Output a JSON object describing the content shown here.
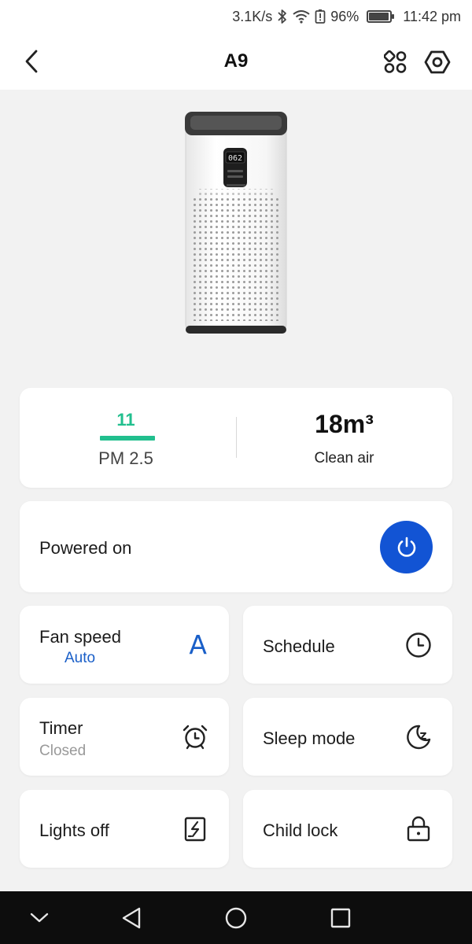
{
  "status_bar": {
    "speed": "3.1K/s",
    "battery": "96%",
    "battery_level": 0.96,
    "time": "11:42 pm",
    "icons": [
      "bluetooth-icon",
      "wifi-icon",
      "battery-alert-icon",
      "battery-icon"
    ]
  },
  "header": {
    "title": "A9",
    "icons": [
      "back-icon",
      "apps-icon",
      "settings-icon"
    ]
  },
  "device": {
    "display_reading": "062",
    "image_icon": "air-purifier-image"
  },
  "stats": {
    "pm_value": "11",
    "pm_label": "PM 2.5",
    "air_value": "18m³",
    "air_label": "Clean air"
  },
  "power": {
    "label": "Powered on",
    "state": "on",
    "icon": "power-icon"
  },
  "tiles": {
    "fan_speed": {
      "label": "Fan speed",
      "value": "Auto",
      "icon_text": "A"
    },
    "schedule": {
      "label": "Schedule",
      "icon": "clock-icon"
    },
    "timer": {
      "label": "Timer",
      "value": "Closed",
      "icon": "alarm-clock-icon"
    },
    "sleep_mode": {
      "label": "Sleep mode",
      "icon": "moon-icon"
    },
    "lights_off": {
      "label": "Lights off",
      "icon": "light-panel-icon"
    },
    "child_lock": {
      "label": "Child lock",
      "icon": "lock-icon"
    }
  },
  "nav_bar": {
    "icons": [
      "collapse-icon",
      "back-triangle-icon",
      "home-circle-icon",
      "recents-square-icon"
    ]
  },
  "colors": {
    "accent_blue": "#1254d4",
    "fan_value_blue": "#1a5fc8",
    "pm_green": "#21bf8e",
    "background": "#f2f2f2"
  }
}
